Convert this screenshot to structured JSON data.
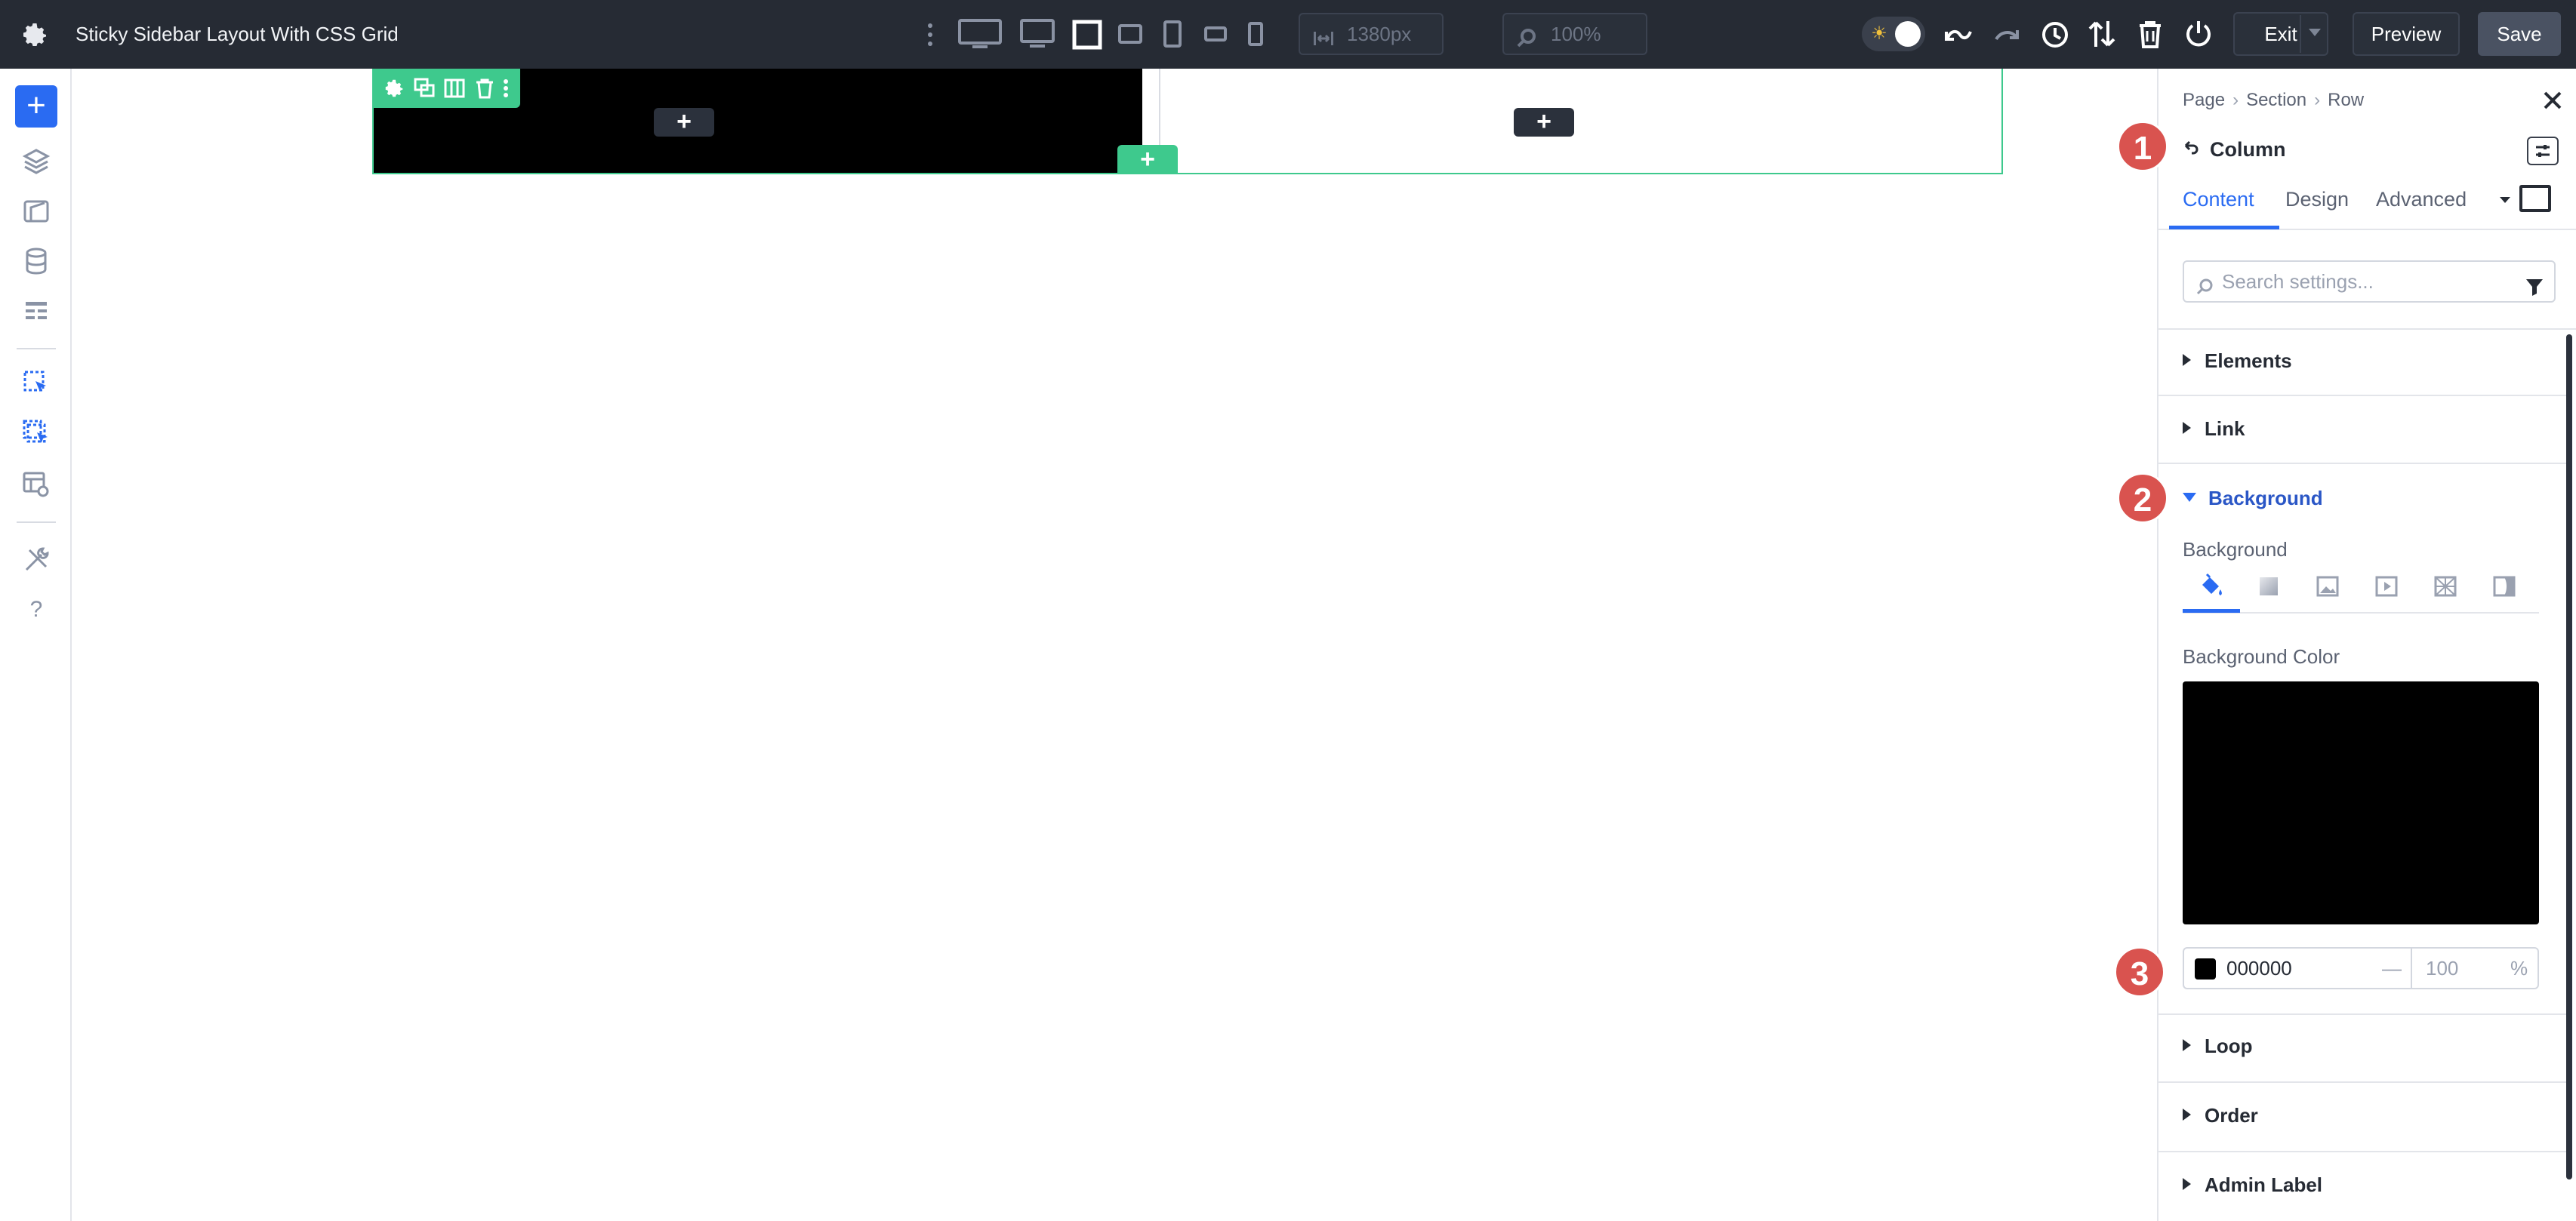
{
  "app": {
    "title": "Sticky Sidebar Layout With CSS Grid"
  },
  "topbar": {
    "width_value": "1380px",
    "zoom_value": "100%",
    "exit_label": "Exit",
    "preview_label": "Preview",
    "save_label": "Save"
  },
  "canvas": {
    "add_symbol": "+"
  },
  "panel": {
    "breadcrumb": [
      "Page",
      "Section",
      "Row"
    ],
    "element_title": "Column",
    "tabs": [
      "Content",
      "Design",
      "Advanced"
    ],
    "active_tab": "Content",
    "search_placeholder": "Search settings...",
    "sections": {
      "elements": "Elements",
      "link": "Link",
      "background": "Background",
      "loop": "Loop",
      "order": "Order",
      "admin_label": "Admin Label"
    },
    "background_sub_label": "Background",
    "background_color_label": "Background Color",
    "background_color_hex": "000000",
    "opacity_dash": "—",
    "opacity_value": "100",
    "opacity_unit": "%"
  },
  "annotations": [
    "1",
    "2",
    "3"
  ],
  "colors": {
    "topbar_bg": "#262b34",
    "accent_blue": "#2a6bf2",
    "builder_green": "#3ec98d",
    "badge_red": "#d9534f",
    "column_bg": "#000000"
  }
}
